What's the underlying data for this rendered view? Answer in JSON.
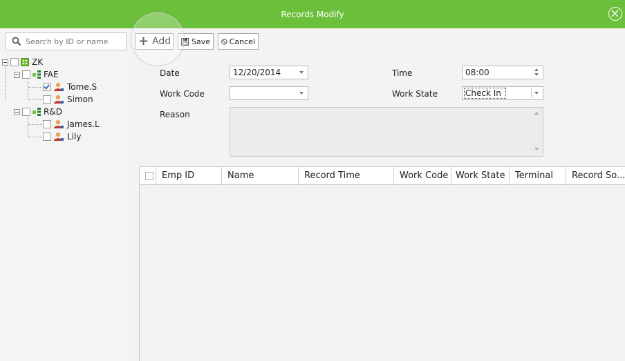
{
  "window": {
    "title": "Records Modify",
    "accent": "#6bbf3a"
  },
  "search": {
    "placeholder": "Search by ID or name"
  },
  "tree": {
    "root": "ZK",
    "groups": [
      {
        "name": "FAE",
        "members": [
          {
            "name": "Tome.S",
            "checked": true
          },
          {
            "name": "Simon",
            "checked": false
          }
        ]
      },
      {
        "name": "R&D",
        "members": [
          {
            "name": "James.L",
            "checked": false
          },
          {
            "name": "Lily",
            "checked": false
          }
        ]
      }
    ]
  },
  "toolbar": {
    "add": "Add",
    "save": "Save",
    "cancel": "Cancel"
  },
  "form": {
    "date_label": "Date",
    "date_value": "12/20/2014",
    "time_label": "Time",
    "time_value": "08:00",
    "workcode_label": "Work Code",
    "workcode_value": "",
    "workstate_label": "Work State",
    "workstate_value": "Check In",
    "reason_label": "Reason"
  },
  "grid": {
    "columns": [
      "Emp ID",
      "Name",
      "Record Time",
      "Work Code",
      "Work State",
      "Terminal",
      "Record So..."
    ]
  }
}
